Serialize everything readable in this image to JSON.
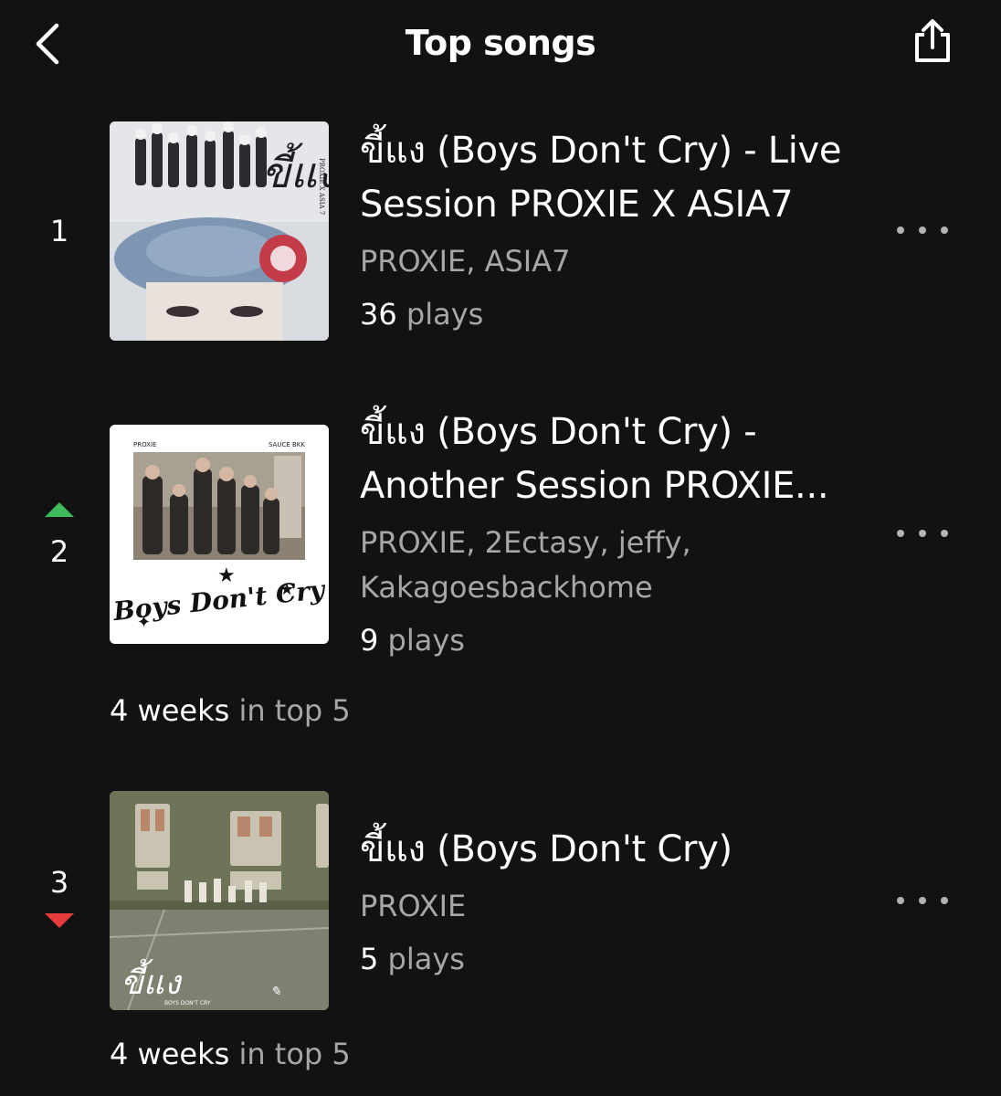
{
  "header": {
    "title": "Top songs"
  },
  "songs": [
    {
      "rank": "1",
      "trend": "none",
      "title": "ขี้แง (Boys Don't Cry) - Live Session PROXIE X ASIA7",
      "artists": "PROXIE, ASIA7",
      "plays_num": "36",
      "plays_label": " plays",
      "cover_text": "ขี้แง",
      "cover_sub": "PROXIE X ASIA 7"
    },
    {
      "rank": "2",
      "trend": "up",
      "title": "ขี้แง (Boys Don't Cry) - Another Session PROXIE...",
      "artists": "PROXIE, 2Ectasy, jeffy, Kakagoesbackhome",
      "plays_num": "9",
      "plays_label": " plays",
      "weeks_num": "4 weeks",
      "weeks_label": " in top 5",
      "cover_tl": "PROXIE",
      "cover_tr": "SAUCE BKK",
      "cover_text": "Boys Don't Cry"
    },
    {
      "rank": "3",
      "trend": "down",
      "title": "ขี้แง (Boys Don't Cry)",
      "artists": "PROXIE",
      "plays_num": "5",
      "plays_label": " plays",
      "weeks_num": "4 weeks",
      "weeks_label": " in top 5",
      "cover_text": "ขี้แง",
      "cover_sub": "BOYS DON'T CRY"
    }
  ],
  "colors": {
    "background": "#121212",
    "up": "#3fb95e",
    "down": "#e63b3b",
    "secondary_text": "#a7a7a7"
  },
  "icons": [
    "chevron-left-icon",
    "share-icon",
    "more-icon"
  ]
}
